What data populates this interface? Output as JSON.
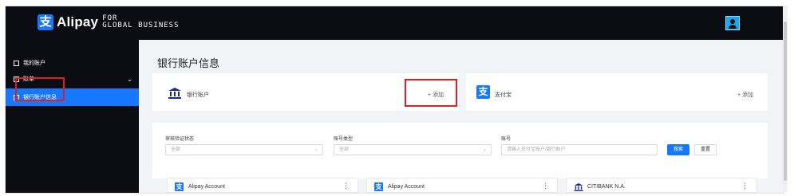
{
  "brand": {
    "logo_glyph": "支",
    "name": "Alipay",
    "tag_line1": "FOR",
    "tag_line2": "GLOBAL BUSINESS"
  },
  "header": {
    "avatar_icon": "user-avatar-icon"
  },
  "sidebar": {
    "items": [
      {
        "label": "我的账户",
        "icon": "account-icon",
        "active": false
      },
      {
        "label": "账单",
        "icon": "bill-icon",
        "active": false,
        "has_chevron": true
      },
      {
        "label": "银行账户信息",
        "icon": "bank-info-icon",
        "active": true
      }
    ],
    "chevron": "⌄"
  },
  "main": {
    "title": "银行账户信息",
    "cards": [
      {
        "label": "银行账户",
        "add_label": "+ 添加",
        "icon": "bank-icon"
      },
      {
        "label": "支付宝",
        "add_label": "+ 添加",
        "icon": "alipay-icon"
      }
    ],
    "filters": [
      {
        "label": "审核验证状态",
        "value": "全部"
      },
      {
        "label": "账号类型",
        "value": "全部"
      },
      {
        "label": "账号",
        "placeholder": "请输入支付宝账户/银行账户"
      }
    ],
    "search_label": "搜索",
    "reset_label": "重置",
    "accounts": [
      {
        "label": "Alipay Account",
        "icon": "alipay-icon"
      },
      {
        "label": "Alipay Account",
        "icon": "alipay-icon"
      },
      {
        "label": "CITIBANK N.A.",
        "icon": "bank-icon"
      }
    ],
    "more_glyph": "⋮"
  },
  "colors": {
    "accent": "#1677ff",
    "topbar": "#0b0d12",
    "highlight": "#e02020"
  }
}
